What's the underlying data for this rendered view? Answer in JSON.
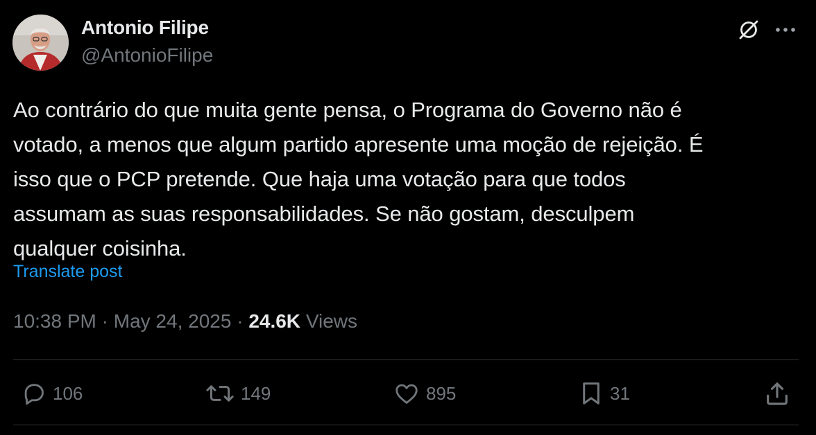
{
  "author": {
    "display_name": "Antonio Filipe",
    "handle": "@AntonioFilipe",
    "avatar_icon": "user-avatar"
  },
  "header_actions": {
    "grok_icon": "grok-icon",
    "more_icon": "more-horizontal-icon"
  },
  "post": {
    "text": "Ao contrário do que muita gente pensa, o Programa do Governo não é\nvotado, a menos que algum partido apresente uma moção de rejeição. É\nisso que o PCP pretende. Que haja uma votação para que todos\nassumam as suas responsabilidades. Se não gostam, desculpem\nqualquer coisinha.",
    "translate_label": "Translate post"
  },
  "meta": {
    "time": "10:38 PM",
    "separator": "·",
    "date": "May 24, 2025",
    "views_count": "24.6K",
    "views_label": "Views"
  },
  "actions": {
    "replies": "106",
    "reposts": "149",
    "likes": "895",
    "bookmarks": "31"
  },
  "colors": {
    "background": "#000000",
    "text_primary": "#e7e9ea",
    "text_secondary": "#71767b",
    "link": "#1d9bf0",
    "divider": "#2f3336"
  }
}
